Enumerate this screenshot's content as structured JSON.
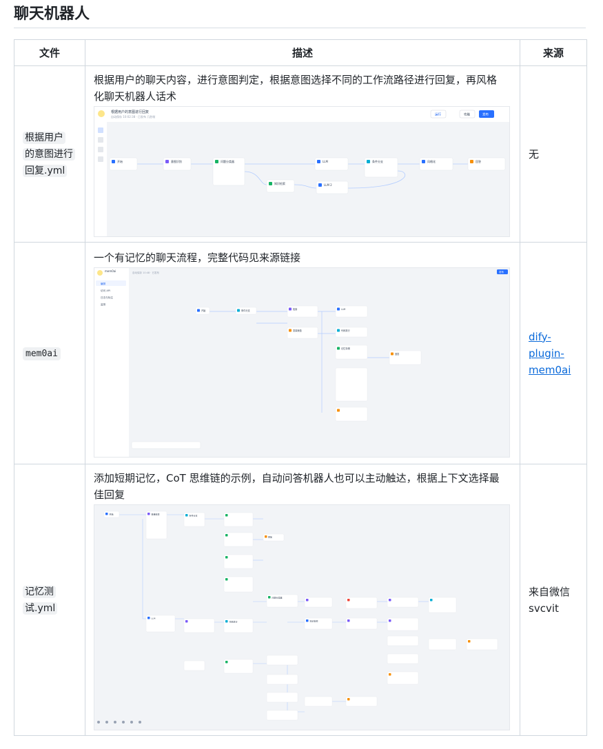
{
  "page": {
    "title": "聊天机器人"
  },
  "table": {
    "headers": {
      "file": "文件",
      "desc": "描述",
      "source": "来源"
    },
    "rows": [
      {
        "file_line1": "根据用户",
        "file_line2": "的意图进行",
        "file_line3": "回复.yml",
        "desc": "根据用户的聊天内容，进行意图判定，根据意图选择不同的工作流路径进行回复，再风格化聊天机器人话术",
        "source": "无",
        "screenshot": {
          "app_title": "根据用户的意图进行回复",
          "subtitle": "自动保存 10:02:38 · 已发布 几秒前",
          "btn_run": "运行",
          "btn_features": "功能",
          "btn_publish": "发布",
          "nodes": [
            "开始",
            "意图识别",
            "问题分类器",
            "LLM",
            "条件分支",
            "回答",
            "知识检索",
            "LLM 2",
            "风格化",
            "直接回复"
          ]
        }
      },
      {
        "file": "mem0ai",
        "desc": "一个有记忆的聊天流程，完整代码见来源链接",
        "source_line1": "dify-",
        "source_line2": "plugin-",
        "source_line3": "mem0ai",
        "screenshot": {
          "app_title": "mem0ai",
          "subtitle": "自动保存 10:48 · 已发布",
          "sidebar": [
            "编排",
            "访问 API",
            "日志与标注",
            "监测"
          ],
          "btn_publish": "发布",
          "nodes": [
            "开始",
            "条件分支",
            "检索",
            "LLM",
            "代码执行",
            "变量赋值",
            "回答",
            "记忆存储"
          ]
        }
      },
      {
        "file_line1": "记忆测",
        "file_line2": "试.yml",
        "desc": "添加短期记忆，CoT 思维链的示例，自动问答机器人也可以主动触达，根据上下文选择最佳回复",
        "source_line1": "来自微信",
        "source_line2": "svcvit",
        "screenshot": {
          "nodes": [
            "开始",
            "变量赋值",
            "条件分支",
            "LLM",
            "代码执行",
            "回答",
            "问题分类器",
            "知识检索"
          ]
        }
      }
    ]
  },
  "colors": {
    "blue": "#2970ff",
    "green": "#16b364",
    "orange": "#f79009",
    "teal": "#06aed4",
    "purple": "#7a5af8",
    "link": "#0969da"
  }
}
